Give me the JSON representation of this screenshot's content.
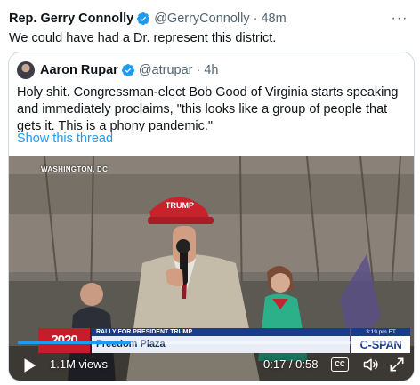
{
  "tweet": {
    "author_name": "Rep. Gerry Connolly",
    "handle": "@GerryConnolly",
    "separator": "·",
    "time": "48m",
    "text": "We could have had a Dr. represent this district.",
    "more_icon": "more-horizontal-icon",
    "more_glyph": "···"
  },
  "quote": {
    "author_name": "Aaron Rupar",
    "handle": "@atrupar",
    "separator": "·",
    "time": "4h",
    "text": "Holy shit. Congressman-elect Bob Good of Virginia starts speaking and immediately proclaims, \"this looks like a group of people that gets it. This is a phony pandemic.\"",
    "show_thread": "Show this thread"
  },
  "video": {
    "location": "WASHINGTON, DC",
    "banner_top": "RALLY FOR PRESIDENT TRUMP",
    "banner_main": "Freedom Plaza",
    "logo": "2020",
    "time_badge": "3:19 pm ET",
    "network": "C-SPAN",
    "views": "1.1M views",
    "current_time": "0:17",
    "duration": "0:58",
    "time_separator": " / ",
    "progress_fraction": 0.293,
    "cc_label": "CC"
  },
  "colors": {
    "accent": "#1d9bf0",
    "text_primary": "#0f1419",
    "text_secondary": "#536471",
    "border": "#cfd9de"
  }
}
